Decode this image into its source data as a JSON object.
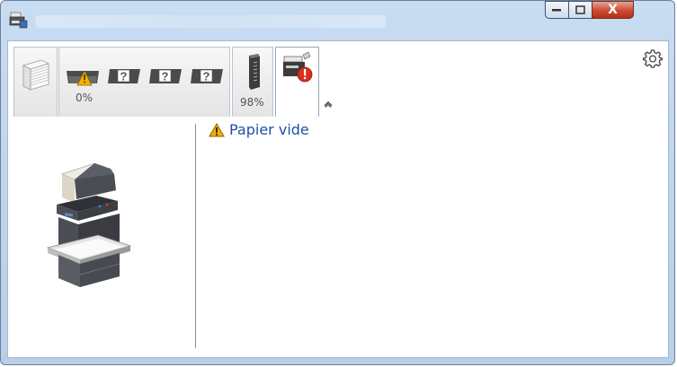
{
  "window": {
    "controls": {
      "minimize_icon": "minimize-icon",
      "maximize_icon": "maximize-icon",
      "close_label": "X"
    }
  },
  "toolbar": {
    "tabs": [
      {
        "icon": "paper-stack-icon"
      },
      {
        "icon": "paper-cassette-warning-icon",
        "label": "0%"
      },
      {
        "icon": "unknown-cassette-icon"
      },
      {
        "icon": "unknown-cassette-icon"
      },
      {
        "icon": "unknown-cassette-icon"
      },
      {
        "icon": "toner-icon",
        "label": "98%"
      },
      {
        "icon": "printer-error-icon"
      }
    ],
    "collapse_icon": "chevron-up-icon",
    "settings_icon": "gear-icon"
  },
  "status": {
    "icon": "warning-icon",
    "message": "Papier vide"
  },
  "colors": {
    "accent": "#1f4fa8",
    "warning": "#f2b200",
    "error": "#d8301e",
    "close_button": "#c94b32"
  }
}
